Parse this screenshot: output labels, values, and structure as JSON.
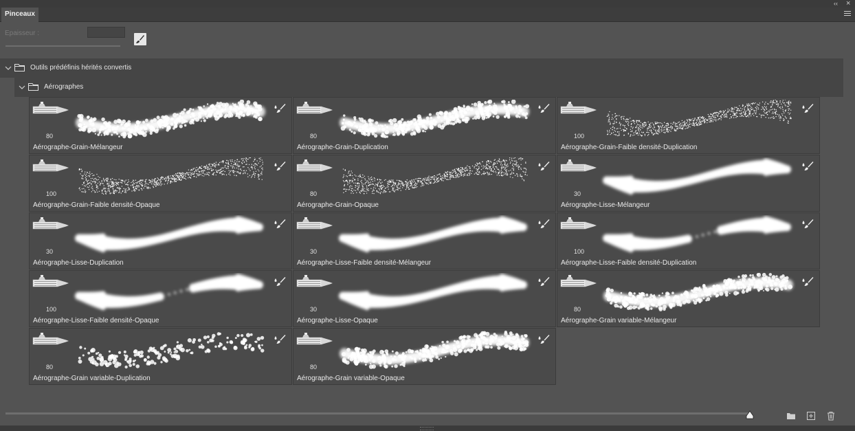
{
  "window": {
    "collapse_glyph": "‹‹",
    "close_glyph": "×"
  },
  "tab": {
    "label": "Pinceaux"
  },
  "size_control": {
    "label": "Epaisseur :",
    "value": ""
  },
  "groups": [
    {
      "label": "Outils prédéfinis hérités convertis"
    },
    {
      "label": "Aérographes"
    }
  ],
  "brushes": [
    {
      "name": "Aérographe-Grain-Mélangeur",
      "size": "80",
      "style": "grain"
    },
    {
      "name": "Aérographe-Grain-Duplication",
      "size": "80",
      "style": "grain"
    },
    {
      "name": "Aérographe-Grain-Faible densité-Duplication",
      "size": "100",
      "style": "speckle"
    },
    {
      "name": "Aérographe-Grain-Faible densité-Opaque",
      "size": "100",
      "style": "speckle"
    },
    {
      "name": "Aérographe-Grain-Opaque",
      "size": "80",
      "style": "speckle"
    },
    {
      "name": "Aérographe-Lisse-Mélangeur",
      "size": "30",
      "style": "smooth"
    },
    {
      "name": "Aérographe-Lisse-Duplication",
      "size": "30",
      "style": "smooth"
    },
    {
      "name": "Aérographe-Lisse-Faible densité-Mélangeur",
      "size": "30",
      "style": "smooth"
    },
    {
      "name": "Aérographe-Lisse-Faible densité-Duplication",
      "size": "100",
      "style": "dotted"
    },
    {
      "name": "Aérographe-Lisse-Faible densité-Opaque",
      "size": "100",
      "style": "dotted"
    },
    {
      "name": "Aérographe-Lisse-Opaque",
      "size": "30",
      "style": "smooth"
    },
    {
      "name": "Aérographe-Grain variable-Mélangeur",
      "size": "80",
      "style": "grain"
    },
    {
      "name": "Aérographe-Grain variable-Duplication",
      "size": "80",
      "style": "chunky"
    },
    {
      "name": "Aérographe-Grain variable-Opaque",
      "size": "80",
      "style": "grain"
    }
  ],
  "icons": {
    "collapse": "double-chevron-icon",
    "close": "close-icon",
    "panel_menu": "hamburger-menu-icon",
    "edit": "brush-edit-icon",
    "folder": "folder-icon",
    "new_group": "new-folder-icon",
    "new_brush": "new-brush-icon",
    "delete": "trash-icon"
  },
  "colors": {
    "panel_bg": "#535353",
    "cell_bg": "#4a4a4a",
    "group_bg": "#454545",
    "stroke": "#ffffff"
  }
}
